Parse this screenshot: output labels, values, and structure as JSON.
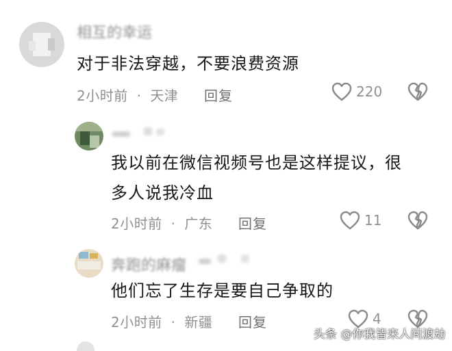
{
  "comments": [
    {
      "username": "相互的幸运",
      "text": "对于非法穿越，不要浪费资源",
      "time": "2小时前",
      "location": "天津",
      "reply_label": "回复",
      "likes": "220"
    },
    {
      "username": "",
      "text_line1": "我以前在微信视频号也是这样提议，很",
      "text_line2": "多人说我冷血",
      "time": "2小时前",
      "location": "广东",
      "reply_label": "回复",
      "likes": "11"
    },
    {
      "username": "奔跑的麻瘤",
      "text": "他们忘了生存是要自己争取的",
      "time": "2小时前",
      "location": "新疆",
      "reply_label": "回复",
      "likes": "4"
    }
  ],
  "separator": "·",
  "watermark": "头条 @你我皆来人间渡劫",
  "icons": {
    "like": "heart-outline-icon",
    "dislike": "broken-heart-icon"
  },
  "colors": {
    "text": "#161616",
    "meta": "#8f8f8f"
  }
}
